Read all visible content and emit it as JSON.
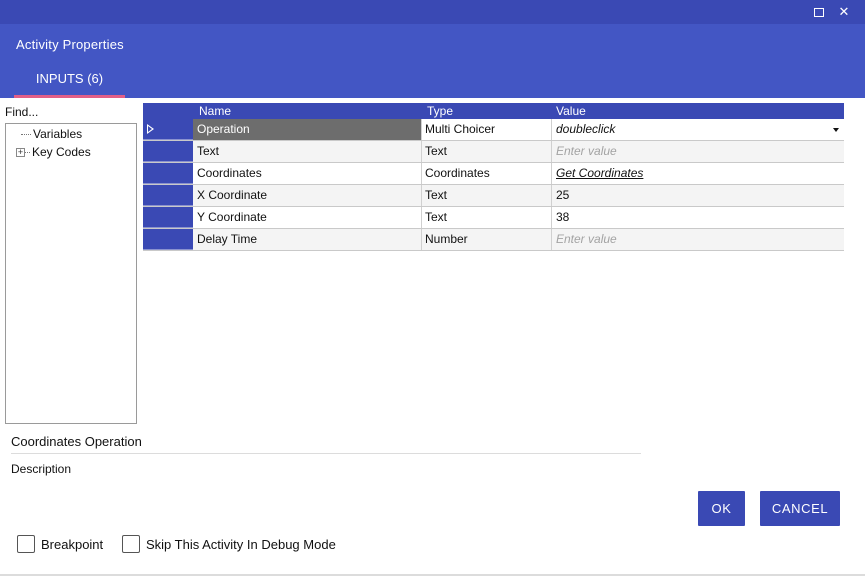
{
  "window": {
    "maximize_glyph": "□",
    "close_glyph": "✕"
  },
  "header": {
    "title": "Activity Properties",
    "tabs": [
      {
        "label": "INPUTS (6)",
        "active": true
      }
    ],
    "accent": "#e25f87",
    "brand": "#4356c4"
  },
  "sidebar": {
    "find_label": "Find...",
    "tree": [
      {
        "label": "Variables",
        "expandable": false
      },
      {
        "label": "Key Codes",
        "expandable": true,
        "expander_glyph": "+"
      }
    ]
  },
  "grid": {
    "columns": [
      "Name",
      "Type",
      "Value"
    ],
    "rows": [
      {
        "name": "Operation",
        "type": "Multi Choicer",
        "value": "doubleclick",
        "value_style": "italic",
        "selected": true,
        "has_dropdown": true
      },
      {
        "name": "Text",
        "type": "Text",
        "value": "Enter value",
        "value_style": "placeholder"
      },
      {
        "name": "Coordinates",
        "type": "Coordinates",
        "value": "Get Coordinates",
        "value_style": "link"
      },
      {
        "name": "X Coordinate",
        "type": "Text",
        "value": "25",
        "value_style": "normal"
      },
      {
        "name": "Y Coordinate",
        "type": "Text",
        "value": "38",
        "value_style": "normal"
      },
      {
        "name": "Delay Time",
        "type": "Number",
        "value": "Enter value",
        "value_style": "placeholder"
      }
    ]
  },
  "description": {
    "title": "Coordinates Operation",
    "text": "Description"
  },
  "buttons": {
    "ok_label": "OK",
    "cancel_label": "CANCEL"
  },
  "options": {
    "breakpoint_label": "Breakpoint",
    "breakpoint_checked": false,
    "skip_label": "Skip This Activity In Debug Mode",
    "skip_checked": false
  }
}
